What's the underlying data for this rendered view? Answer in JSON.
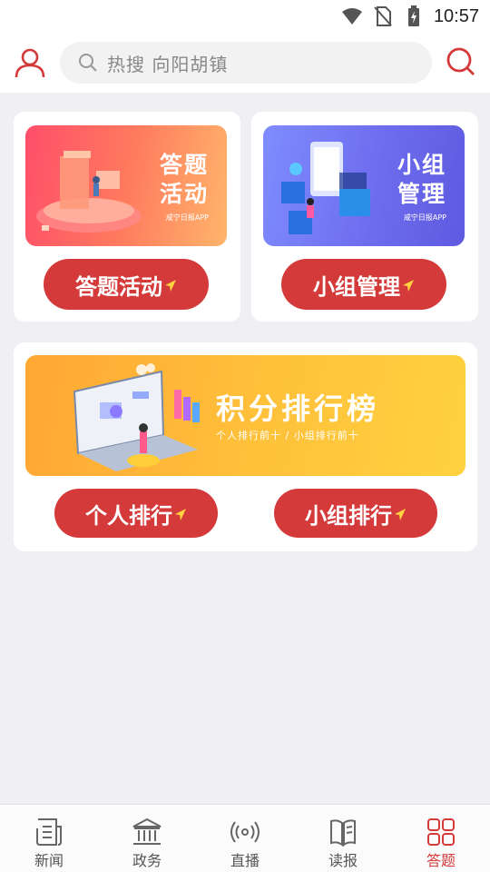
{
  "status_bar": {
    "time": "10:57"
  },
  "header": {
    "search_placeholder": "热搜 向阳胡镇"
  },
  "cards": {
    "quiz": {
      "banner_title_line1": "答题",
      "banner_title_line2": "活动",
      "banner_sub": "咸宁日报APP",
      "button_label": "答题活动"
    },
    "group": {
      "banner_title_line1": "小组",
      "banner_title_line2": "管理",
      "banner_sub": "咸宁日报APP",
      "button_label": "小组管理"
    },
    "ranking": {
      "banner_title": "积分排行榜",
      "banner_sub": "个人排行前十 / 小组排行前十",
      "personal_button": "个人排行",
      "group_button": "小组排行"
    }
  },
  "bottom_nav": {
    "items": [
      {
        "label": "新闻",
        "icon": "newspaper-icon"
      },
      {
        "label": "政务",
        "icon": "government-building-icon"
      },
      {
        "label": "直播",
        "icon": "live-broadcast-icon"
      },
      {
        "label": "读报",
        "icon": "read-paper-icon"
      },
      {
        "label": "答题",
        "icon": "quiz-grid-icon"
      }
    ],
    "active_index": 4
  },
  "colors": {
    "accent": "#d43a3a",
    "background": "#f0f0f4"
  }
}
